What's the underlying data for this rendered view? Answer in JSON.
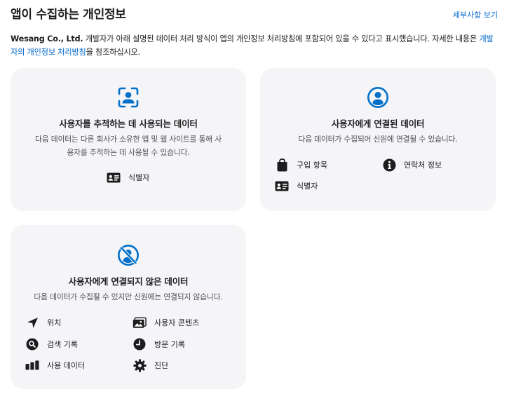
{
  "header": {
    "title": "앱이 수집하는 개인정보",
    "details_link": "세부사항 보기"
  },
  "description": {
    "developer": "Wesang Co., Ltd.",
    "text_after_developer": " 개발자가 아래 설명된 데이터 처리 방식이 앱의 개인정보 처리방침에 포함되어 있을 수 있다고 표시했습니다. 자세한 내용은 ",
    "policy_link": "개발자의 개인정보 처리방침",
    "text_end": "을 참조하십시오."
  },
  "cards": {
    "tracking": {
      "icon": "tracking-icon",
      "title": "사용자를 추적하는 데 사용되는 데이터",
      "description": "다음 데이터는 다른 회사가 소유한 앱 및 웹 사이트를 통해 사용자를 추적하는 데 사용될 수 있습니다.",
      "items": [
        {
          "icon": "id-card-icon",
          "label": "식별자"
        }
      ]
    },
    "linked": {
      "icon": "person-circle-icon",
      "title": "사용자에게 연결된 데이터",
      "description": "다음 데이터가 수집되어 신원에 연결될 수 있습니다.",
      "items": [
        {
          "icon": "shopping-bag-icon",
          "label": "구입 항목"
        },
        {
          "icon": "info-icon",
          "label": "연락처 정보"
        },
        {
          "icon": "id-card-icon",
          "label": "식별자"
        }
      ]
    },
    "not_linked": {
      "icon": "person-slash-icon",
      "title": "사용자에게 연결되지 않은 데이터",
      "description": "다음 데이터가 수집될 수 있지만 신원에는 연결되지 않습니다.",
      "items": [
        {
          "icon": "location-arrow-icon",
          "label": "위치"
        },
        {
          "icon": "photos-icon",
          "label": "사용자 콘텐츠"
        },
        {
          "icon": "search-icon",
          "label": "검색 기록"
        },
        {
          "icon": "clock-icon",
          "label": "방문 기록"
        },
        {
          "icon": "bar-chart-icon",
          "label": "사용 데이터"
        },
        {
          "icon": "gear-icon",
          "label": "진단"
        }
      ]
    }
  },
  "colors": {
    "accent": "#0070c9",
    "link": "#0066cc",
    "card_bg": "#f5f5f7",
    "text": "#1d1d1f"
  }
}
